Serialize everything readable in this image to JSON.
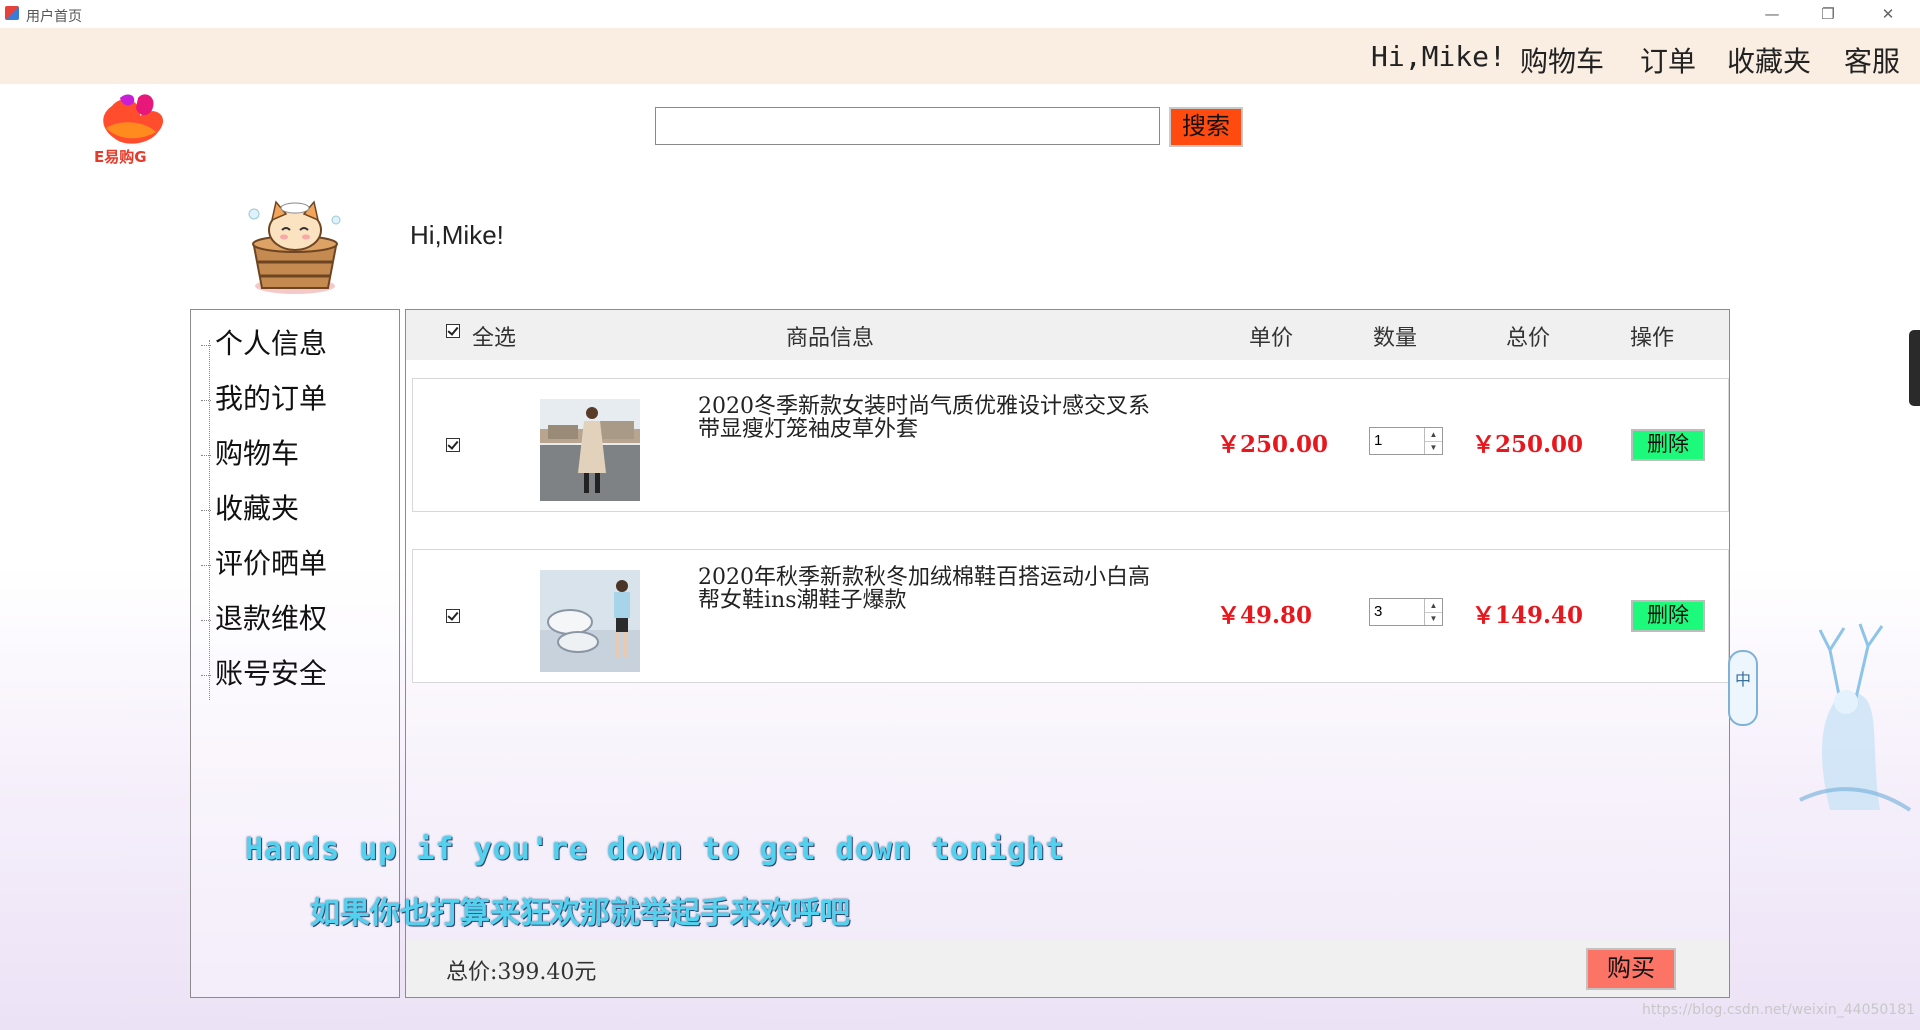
{
  "window": {
    "title": "用户首页",
    "controls": {
      "minimize": "—",
      "restore": "❐",
      "close": "✕"
    }
  },
  "topnav": {
    "greeting": "Hi,Mike!",
    "items": [
      "购物车",
      "订单",
      "收藏夹",
      "客服"
    ]
  },
  "logo": {
    "text": "E易购G"
  },
  "search": {
    "value": "",
    "placeholder": "",
    "button_label": "搜索"
  },
  "user": {
    "greeting": "Hi,Mike!"
  },
  "sidebar": {
    "items": [
      "个人信息",
      "我的订单",
      "购物车",
      "收藏夹",
      "评价晒单",
      "退款维权",
      "账号安全"
    ]
  },
  "cart": {
    "headers": {
      "select_all": "全选",
      "product_info": "商品信息",
      "unit_price": "单价",
      "quantity": "数量",
      "total_price": "总价",
      "actions": "操作"
    },
    "rows": [
      {
        "name": "2020冬季新款女装时尚气质优雅设计感交叉系带显瘦灯笼袖皮草外套",
        "unit_price": "￥250.00",
        "quantity": "1",
        "total": "￥250.00",
        "delete_label": "删除",
        "checked": true
      },
      {
        "name": "2020年秋季新款秋冬加绒棉鞋百搭运动小白高帮女鞋ins潮鞋子爆款",
        "unit_price": "￥49.80",
        "quantity": "3",
        "total": "￥149.40",
        "delete_label": "删除",
        "checked": true
      }
    ],
    "footer": {
      "total_text": "总价:399.40元",
      "buy_label": "购买"
    }
  },
  "overlay": {
    "subtitle_en": "Hands up if you're down to get down tonight",
    "subtitle_zh": "如果你也打算来狂欢那就举起手来欢呼吧",
    "ime_label": "中",
    "watermark": "https://blog.csdn.net/weixin_44050181"
  },
  "colors": {
    "nav_bg": "#faeee3",
    "search_button": "#ff4a10",
    "delete_button": "#1df97a",
    "buy_button": "#fb7466",
    "price_red": "#e8161d",
    "subtitle": "#52d2ee"
  }
}
